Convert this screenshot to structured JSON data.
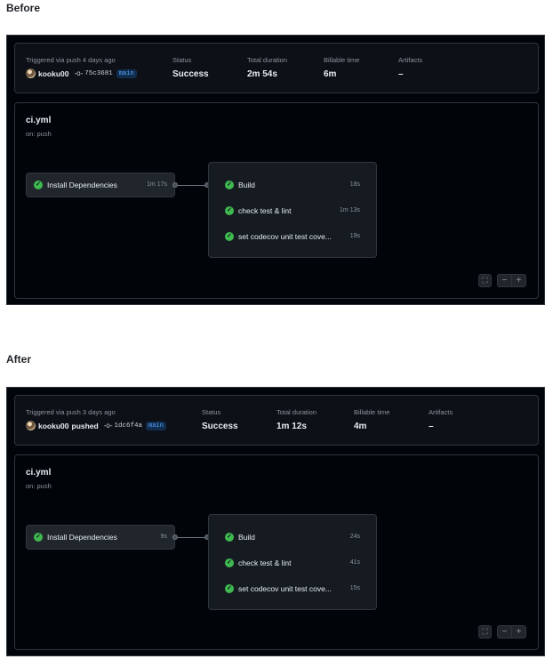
{
  "panels": [
    {
      "heading": "Before",
      "summary": {
        "trigger_label": "Triggered via push 4 days ago",
        "user": "kooku00",
        "user_suffix": "",
        "commit_sha": "75c3681",
        "branch": "main",
        "status_label": "Status",
        "status_value": "Success",
        "duration_label": "Total duration",
        "duration_value": "2m 54s",
        "billable_label": "Billable time",
        "billable_value": "6m",
        "artifacts_label": "Artifacts",
        "artifacts_value": "–"
      },
      "workflow": {
        "name": "ci.yml",
        "trigger": "on: push",
        "job": {
          "name": "Install Dependencies",
          "duration": "1m 17s"
        },
        "steps": [
          {
            "name": "Build",
            "duration": "18s"
          },
          {
            "name": "check test & lint",
            "duration": "1m 13s"
          },
          {
            "name": "set codecov unit test cove...",
            "duration": "19s"
          }
        ]
      }
    },
    {
      "heading": "After",
      "summary": {
        "trigger_label": "Triggered via push 3 days ago",
        "user": "kooku00",
        "user_suffix": "pushed",
        "commit_sha": "1dc6f4a",
        "branch": "main",
        "status_label": "Status",
        "status_value": "Success",
        "duration_label": "Total duration",
        "duration_value": "1m 12s",
        "billable_label": "Billable time",
        "billable_value": "4m",
        "artifacts_label": "Artifacts",
        "artifacts_value": "–"
      },
      "workflow": {
        "name": "ci.yml",
        "trigger": "on: push",
        "job": {
          "name": "Install Dependencies",
          "duration": "9s"
        },
        "steps": [
          {
            "name": "Build",
            "duration": "24s"
          },
          {
            "name": "check test & lint",
            "duration": "41s"
          },
          {
            "name": "set codecov unit test cove...",
            "duration": "15s"
          }
        ]
      }
    }
  ],
  "icons": {
    "success": "check-circle-icon",
    "commit": "git-commit-icon",
    "fullscreen": "fullscreen-icon",
    "zoom_out": "minus-icon",
    "zoom_in": "plus-icon"
  },
  "colors": {
    "success": "#3fb950",
    "background": "#010409",
    "branch": "#58a6ff"
  }
}
